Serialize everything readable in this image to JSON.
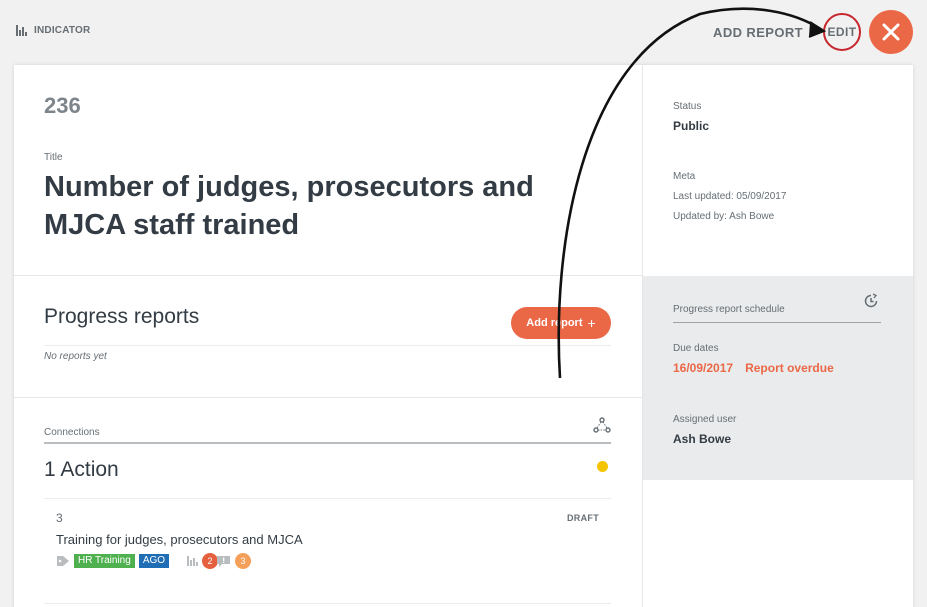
{
  "topbar": {
    "breadcrumb": "INDICATOR",
    "add_report": "ADD REPORT",
    "edit": "EDIT"
  },
  "indicator": {
    "ref": "236",
    "title_label": "Title",
    "title": "Number of judges, prosecutors and MJCA staff trained"
  },
  "progress": {
    "heading": "Progress reports",
    "add_button": "Add report",
    "add_symbol": "+",
    "empty": "No reports yet"
  },
  "connections": {
    "label": "Connections",
    "heading": "1 Action",
    "item": {
      "ref": "3",
      "status": "DRAFT",
      "title": "Training for judges, prosecutors and MJCA",
      "tags": [
        "HR Training",
        "AGO"
      ],
      "counts": [
        "2",
        "3"
      ]
    }
  },
  "sidebar": {
    "status_label": "Status",
    "status_value": "Public",
    "meta_label": "Meta",
    "last_updated": "Last updated: 05/09/2017",
    "updated_by": "Updated by: Ash Bowe",
    "schedule_label": "Progress report schedule",
    "due_label": "Due dates",
    "due_date": "16/09/2017",
    "overdue": "Report overdue",
    "assigned_label": "Assigned user",
    "assigned_value": "Ash Bowe"
  },
  "colors": {
    "accent": "#eb6847",
    "edit_ring": "#c7262e",
    "status_dot": "#f5c400",
    "tag_green": "#4fb04f",
    "tag_blue": "#1f6db5"
  }
}
